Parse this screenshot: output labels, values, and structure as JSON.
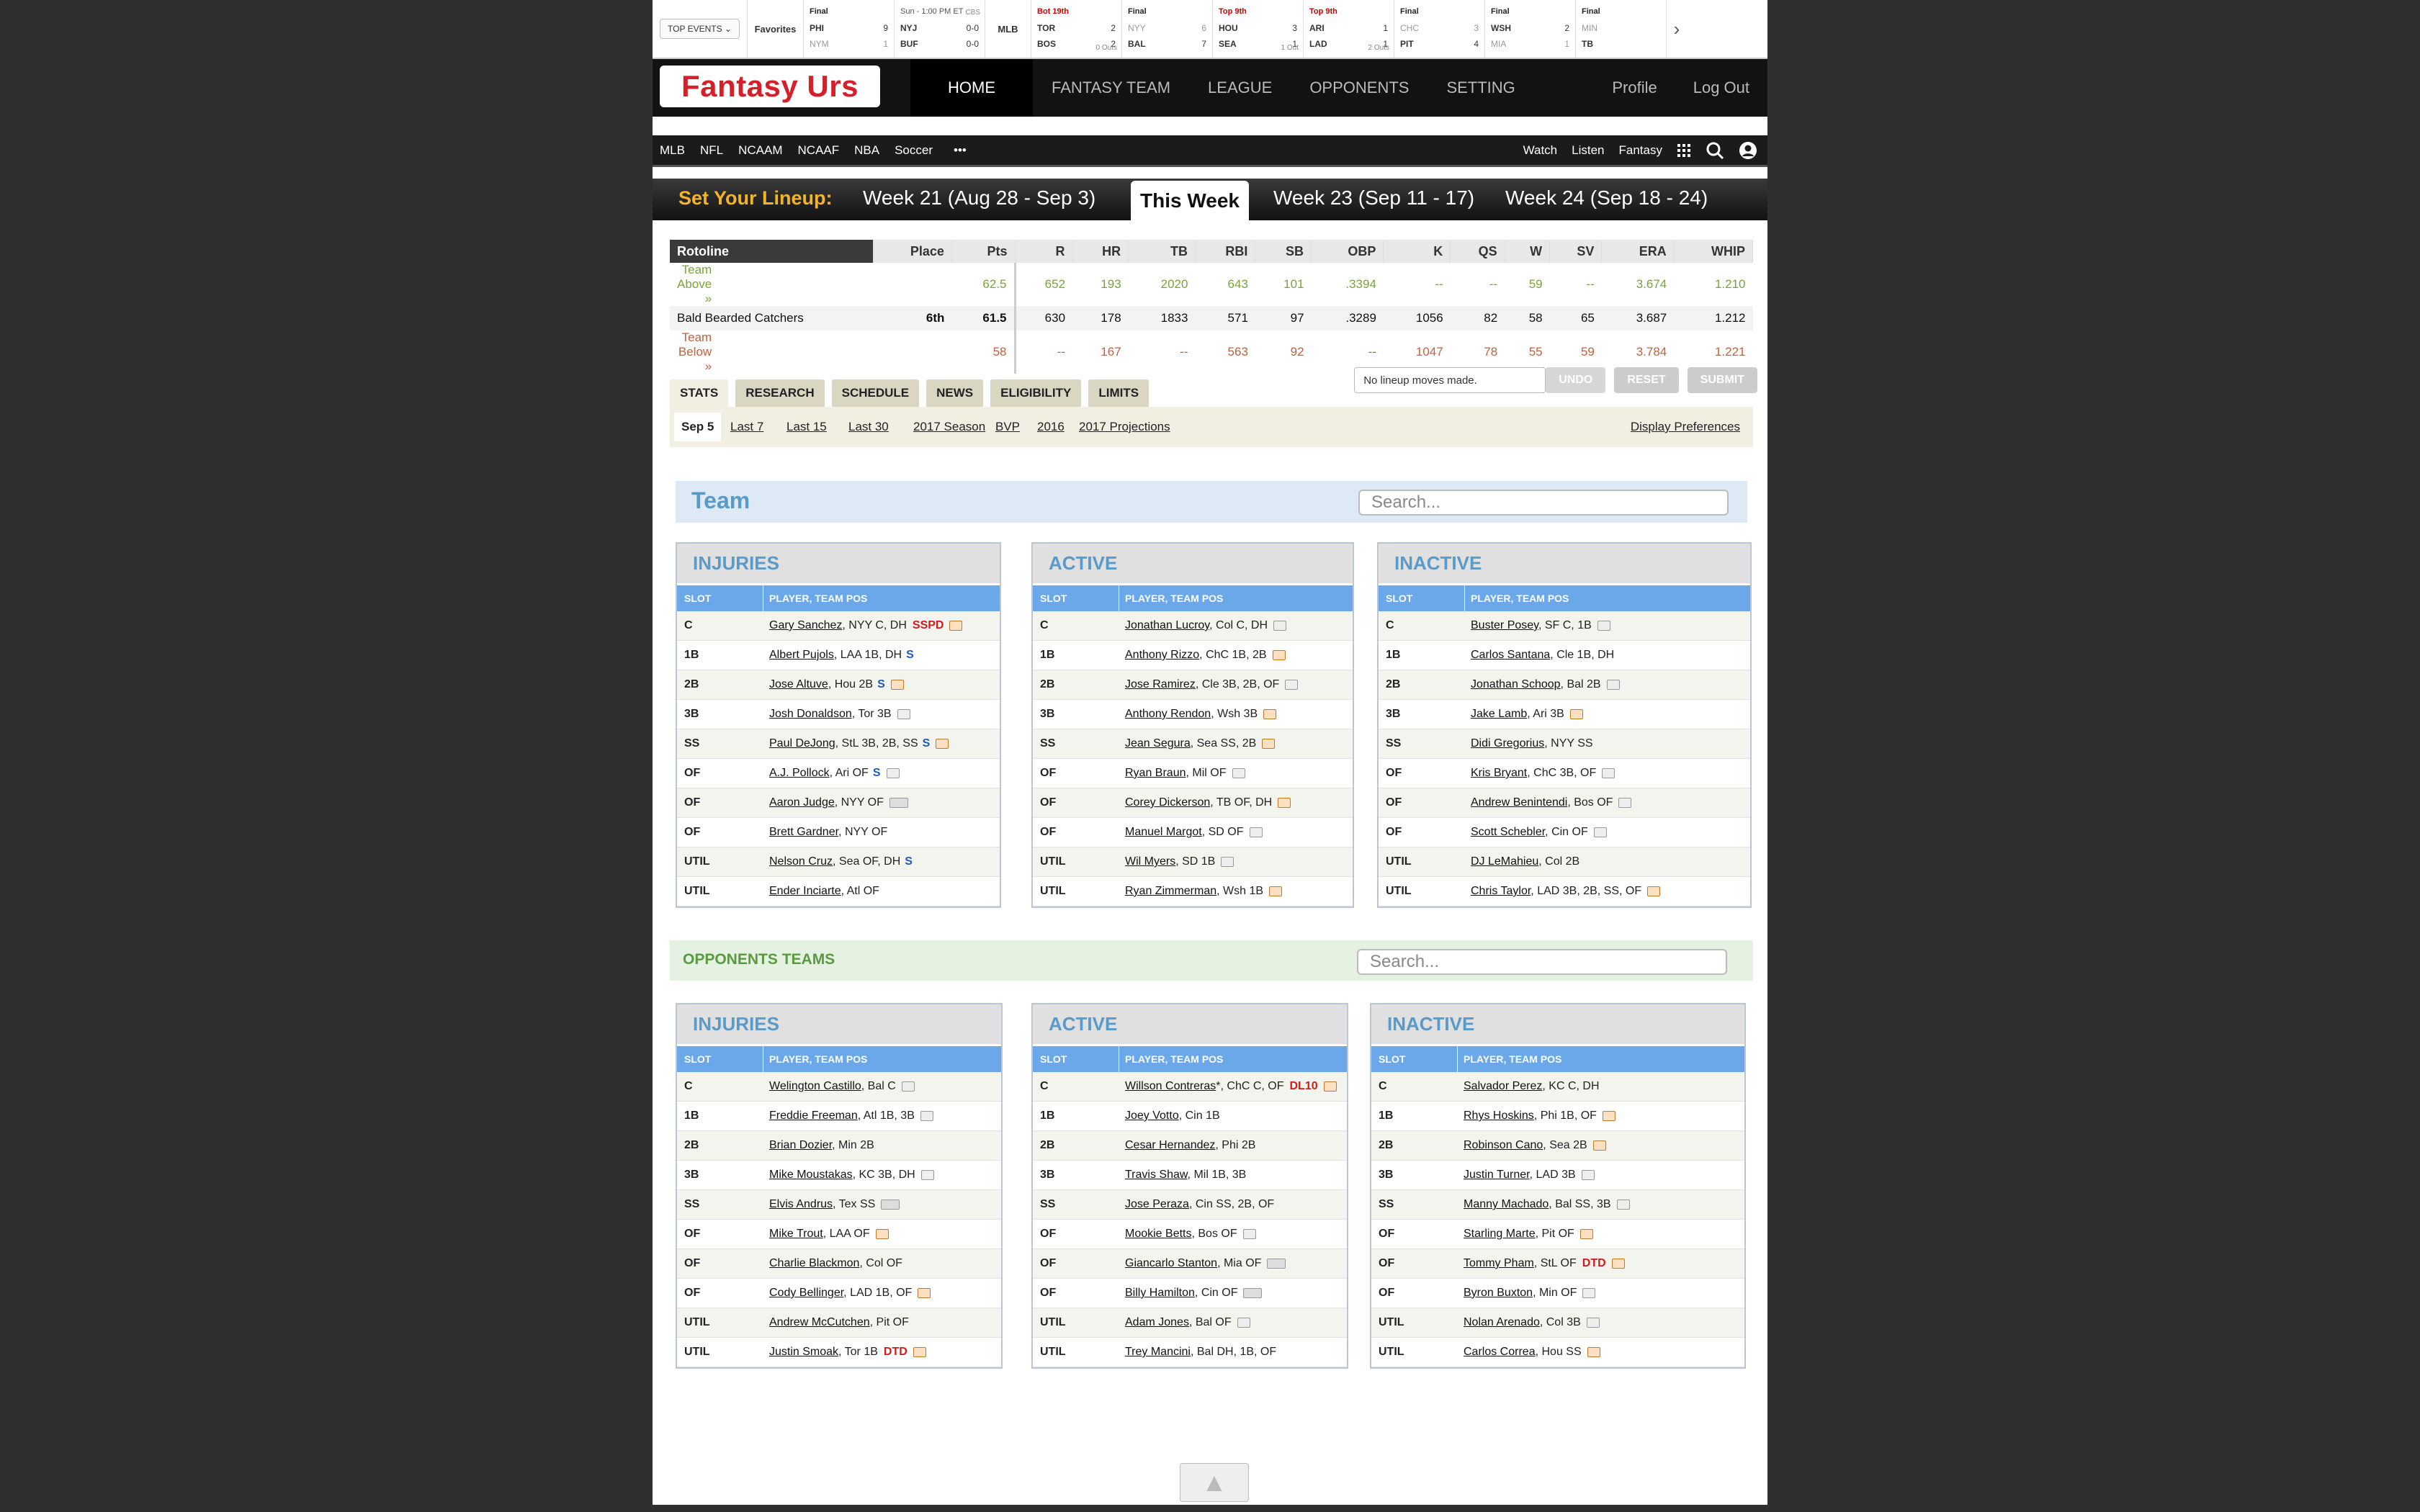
{
  "scores": {
    "top_events": "TOP EVENTS ⌄",
    "favorites": "Favorites",
    "games1": [
      {
        "status": "Final",
        "cls": "",
        "a": "PHI",
        "as": "9",
        "b": "NYM",
        "bs": "1",
        "loser": "b"
      },
      {
        "status": "Sun - 1:00 PM ET",
        "cls": "gray",
        "net": "CBS",
        "a": "NYJ",
        "as": "0-0",
        "b": "BUF",
        "bs": "0-0",
        "loser": ""
      }
    ],
    "league": "MLB",
    "games2": [
      {
        "status": "Bot 19th",
        "cls": "red",
        "a": "TOR",
        "as": "2",
        "b": "BOS",
        "bs": "2",
        "extra": "0 Outs",
        "loser": ""
      },
      {
        "status": "Final",
        "cls": "",
        "a": "NYY",
        "as": "6",
        "b": "BAL",
        "bs": "7",
        "loser": "a"
      },
      {
        "status": "Top 9th",
        "cls": "red",
        "a": "HOU",
        "as": "3",
        "b": "SEA",
        "bs": "1",
        "extra": "1 Out",
        "loser": ""
      },
      {
        "status": "Top 9th",
        "cls": "red",
        "a": "ARI",
        "as": "1",
        "b": "LAD",
        "bs": "1",
        "extra": "2 Outs",
        "loser": ""
      },
      {
        "status": "Final",
        "cls": "",
        "a": "CHC",
        "as": "3",
        "b": "PIT",
        "bs": "4",
        "loser": "a"
      },
      {
        "status": "Final",
        "cls": "",
        "a": "WSH",
        "as": "2",
        "b": "MIA",
        "bs": "1",
        "loser": "b"
      },
      {
        "status": "Final",
        "cls": "",
        "a": "MIN",
        "as": "",
        "b": "TB",
        "bs": "",
        "loser": "a"
      }
    ],
    "next": "›"
  },
  "brand": "Fantasy Urs",
  "nav": {
    "home": "HOME",
    "team": "FANTASY TEAM",
    "league": "LEAGUE",
    "opponents": "OPPONENTS",
    "setting": "SETTING",
    "profile": "Profile",
    "logout": "Log Out"
  },
  "sports": {
    "mlb": "MLB",
    "nfl": "NFL",
    "ncaam": "NCAAM",
    "ncaaf": "NCAAF",
    "nba": "NBA",
    "soccer": "Soccer",
    "more": "•••",
    "watch": "Watch",
    "listen": "Listen",
    "fantasy": "Fantasy"
  },
  "lineup": {
    "label": "Set Your Lineup:",
    "w21": "Week 21 (Aug 28 - Sep 3)",
    "this": "This Week",
    "w23": "Week 23 (Sep 11 - 17)",
    "w24": "Week 24 (Sep 18 - 24)"
  },
  "roto": {
    "headers": [
      "Rotoline",
      "Place",
      "Pts",
      "R",
      "HR",
      "TB",
      "RBI",
      "SB",
      "OBP",
      "K",
      "QS",
      "W",
      "SV",
      "ERA",
      "WHIP"
    ],
    "rows": [
      [
        "Team Above »",
        "",
        "62.5",
        "652",
        "193",
        "2020",
        "643",
        "101",
        ".3394",
        "--",
        "--",
        "59",
        "--",
        "3.674",
        "1.210"
      ],
      [
        "Bald Bearded Catchers",
        "6th",
        "61.5",
        "630",
        "178",
        "1833",
        "571",
        "97",
        ".3289",
        "1056",
        "82",
        "58",
        "65",
        "3.687",
        "1.212"
      ],
      [
        "Team Below »",
        "",
        "58",
        "--",
        "167",
        "--",
        "563",
        "92",
        "--",
        "1047",
        "78",
        "55",
        "59",
        "3.784",
        "1.221"
      ]
    ]
  },
  "tabs": {
    "stats": "STATS",
    "research": "RESEARCH",
    "schedule": "SCHEDULE",
    "news": "NEWS",
    "eligibility": "ELIGIBILITY",
    "limits": "LIMITS"
  },
  "actions": {
    "msg": "No lineup moves made.",
    "undo": "UNDO",
    "reset": "RESET",
    "submit": "SUBMIT"
  },
  "subtabs": {
    "sep5": "Sep 5",
    "last7": "Last 7",
    "last15": "Last 15",
    "last30": "Last 30",
    "s2017": "2017 Season",
    "bvp": "BVP",
    "y2016": "2016",
    "proj": "2017 Projections",
    "prefs": "Display Preferences"
  },
  "team_title": "Team",
  "search_placeholder": "Search...",
  "opp_title": "OPPONENTS TEAMS",
  "col_slot": "SLOT",
  "col_player": "PLAYER, TEAM POS",
  "team": {
    "injuries": {
      "title": "INJURIES",
      "rows": [
        {
          "slot": "C",
          "name": "Gary Sanchez",
          "info": ", NYY C, DH",
          "badge": "SSPD",
          "icon": "orange"
        },
        {
          "slot": "1B",
          "name": "Albert Pujols",
          "info": ", LAA 1B, DH",
          "sb": "S"
        },
        {
          "slot": "2B",
          "name": "Jose Altuve",
          "info": ", Hou 2B",
          "sb": "S",
          "icon": "orange"
        },
        {
          "slot": "3B",
          "name": "Josh Donaldson",
          "info": ", Tor 3B",
          "icon": "plain"
        },
        {
          "slot": "SS",
          "name": "Paul DeJong",
          "info": ", StL 3B, 2B, SS",
          "sb": "S",
          "icon": "orange"
        },
        {
          "slot": "OF",
          "name": "A.J. Pollock",
          "info": ", Ari OF",
          "sb": "S",
          "icon": "plain"
        },
        {
          "slot": "OF",
          "name": "Aaron Judge",
          "info": ", NYY OF",
          "icon": "multi"
        },
        {
          "slot": "OF",
          "name": "Brett Gardner",
          "info": ", NYY OF"
        },
        {
          "slot": "UTIL",
          "name": "Nelson Cruz",
          "info": ", Sea OF, DH",
          "sb": "S"
        },
        {
          "slot": "UTIL",
          "name": "Ender Inciarte",
          "info": ", Atl OF"
        }
      ]
    },
    "active": {
      "title": "ACTIVE",
      "rows": [
        {
          "slot": "C",
          "name": "Jonathan Lucroy",
          "info": ", Col C, DH",
          "icon": "plain"
        },
        {
          "slot": "1B",
          "name": "Anthony Rizzo",
          "info": ", ChC 1B, 2B",
          "icon": "orange"
        },
        {
          "slot": "2B",
          "name": "Jose Ramirez",
          "info": ", Cle 3B, 2B, OF",
          "icon": "plain"
        },
        {
          "slot": "3B",
          "name": "Anthony Rendon",
          "info": ", Wsh 3B",
          "icon": "orange"
        },
        {
          "slot": "SS",
          "name": "Jean Segura",
          "info": ", Sea SS, 2B",
          "icon": "orange"
        },
        {
          "slot": "OF",
          "name": "Ryan Braun",
          "info": ", Mil OF",
          "icon": "plain"
        },
        {
          "slot": "OF",
          "name": "Corey Dickerson",
          "info": ", TB OF, DH",
          "icon": "orange"
        },
        {
          "slot": "OF",
          "name": "Manuel Margot",
          "info": ", SD OF",
          "icon": "plain"
        },
        {
          "slot": "UTIL",
          "name": "Wil Myers",
          "info": ", SD 1B",
          "icon": "plain"
        },
        {
          "slot": "UTIL",
          "name": "Ryan Zimmerman",
          "info": ", Wsh 1B",
          "icon": "orange"
        }
      ]
    },
    "inactive": {
      "title": "INACTIVE",
      "rows": [
        {
          "slot": "C",
          "name": "Buster Posey",
          "info": ", SF C, 1B",
          "icon": "plain"
        },
        {
          "slot": "1B",
          "name": "Carlos Santana",
          "info": ", Cle 1B, DH"
        },
        {
          "slot": "2B",
          "name": "Jonathan Schoop",
          "info": ", Bal 2B",
          "icon": "plain"
        },
        {
          "slot": "3B",
          "name": "Jake Lamb",
          "info": ", Ari 3B",
          "icon": "orange"
        },
        {
          "slot": "SS",
          "name": "Didi Gregorius",
          "info": ", NYY SS"
        },
        {
          "slot": "OF",
          "name": "Kris Bryant",
          "info": ", ChC 3B, OF",
          "icon": "plain"
        },
        {
          "slot": "OF",
          "name": "Andrew Benintendi",
          "info": ", Bos OF",
          "icon": "plain"
        },
        {
          "slot": "OF",
          "name": "Scott Schebler",
          "info": ", Cin OF",
          "icon": "plain"
        },
        {
          "slot": "UTIL",
          "name": "DJ LeMahieu",
          "info": ", Col 2B"
        },
        {
          "slot": "UTIL",
          "name": "Chris Taylor",
          "info": ", LAD 3B, 2B, SS, OF",
          "icon": "orange"
        }
      ]
    }
  },
  "opp": {
    "injuries": {
      "title": "INJURIES",
      "rows": [
        {
          "slot": "C",
          "name": "Welington Castillo",
          "info": ", Bal C",
          "icon": "plain"
        },
        {
          "slot": "1B",
          "name": "Freddie Freeman",
          "info": ", Atl 1B, 3B",
          "icon": "plain"
        },
        {
          "slot": "2B",
          "name": "Brian Dozier",
          "info": ", Min 2B"
        },
        {
          "slot": "3B",
          "name": "Mike Moustakas",
          "info": ", KC 3B, DH",
          "icon": "plain"
        },
        {
          "slot": "SS",
          "name": "Elvis Andrus",
          "info": ", Tex SS",
          "icon": "multi"
        },
        {
          "slot": "OF",
          "name": "Mike Trout",
          "info": ", LAA OF",
          "icon": "orange"
        },
        {
          "slot": "OF",
          "name": "Charlie Blackmon",
          "info": ", Col OF"
        },
        {
          "slot": "OF",
          "name": "Cody Bellinger",
          "info": ", LAD 1B, OF",
          "icon": "orange"
        },
        {
          "slot": "UTIL",
          "name": "Andrew McCutchen",
          "info": ", Pit OF"
        },
        {
          "slot": "UTIL",
          "name": "Justin Smoak",
          "info": ", Tor 1B",
          "badge": "DTD",
          "icon": "orange"
        }
      ]
    },
    "active": {
      "title": "ACTIVE",
      "rows": [
        {
          "slot": "C",
          "name": "Willson Contreras",
          "info": "*, ChC C, OF",
          "badge": "DL10",
          "icon": "orange"
        },
        {
          "slot": "1B",
          "name": "Joey Votto",
          "info": ", Cin 1B"
        },
        {
          "slot": "2B",
          "name": "Cesar Hernandez",
          "info": ", Phi 2B"
        },
        {
          "slot": "3B",
          "name": "Travis Shaw",
          "info": ", Mil 1B, 3B"
        },
        {
          "slot": "SS",
          "name": "Jose Peraza",
          "info": ", Cin SS, 2B, OF"
        },
        {
          "slot": "OF",
          "name": "Mookie Betts",
          "info": ", Bos OF",
          "icon": "plain"
        },
        {
          "slot": "OF",
          "name": "Giancarlo Stanton",
          "info": ", Mia OF",
          "icon": "multi"
        },
        {
          "slot": "OF",
          "name": "Billy Hamilton",
          "info": ", Cin OF",
          "icon": "multi"
        },
        {
          "slot": "UTIL",
          "name": "Adam Jones",
          "info": ", Bal OF",
          "icon": "plain"
        },
        {
          "slot": "UTIL",
          "name": "Trey Mancini",
          "info": ", Bal DH, 1B, OF"
        }
      ]
    },
    "inactive": {
      "title": "INACTIVE",
      "rows": [
        {
          "slot": "C",
          "name": "Salvador Perez",
          "info": ", KC C, DH"
        },
        {
          "slot": "1B",
          "name": "Rhys Hoskins",
          "info": ", Phi 1B, OF",
          "icon": "orange"
        },
        {
          "slot": "2B",
          "name": "Robinson Cano",
          "info": ", Sea 2B",
          "icon": "orange"
        },
        {
          "slot": "3B",
          "name": "Justin Turner",
          "info": ", LAD 3B",
          "icon": "plain"
        },
        {
          "slot": "SS",
          "name": "Manny Machado",
          "info": ", Bal SS, 3B",
          "icon": "plain"
        },
        {
          "slot": "OF",
          "name": "Starling Marte",
          "info": ", Pit OF",
          "icon": "orange"
        },
        {
          "slot": "OF",
          "name": "Tommy Pham",
          "info": ", StL OF",
          "badge": "DTD",
          "icon": "orange"
        },
        {
          "slot": "OF",
          "name": "Byron Buxton",
          "info": ", Min OF",
          "icon": "plain"
        },
        {
          "slot": "UTIL",
          "name": "Nolan Arenado",
          "info": ", Col 3B",
          "icon": "plain"
        },
        {
          "slot": "UTIL",
          "name": "Carlos Correa",
          "info": ", Hou SS",
          "icon": "orange"
        }
      ]
    }
  },
  "scroll_top": "▲"
}
